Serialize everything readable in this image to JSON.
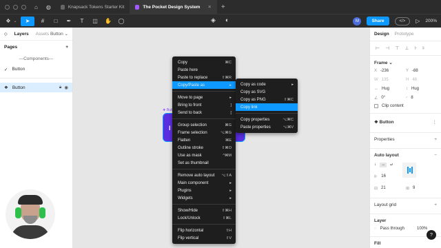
{
  "titlebar": {
    "tabs": [
      {
        "label": "Knapsack Tokens Starter Kit",
        "active": false
      },
      {
        "label": "The Pocket Design System",
        "active": true
      }
    ],
    "add": "+"
  },
  "toolbar": {
    "user_initial": "M",
    "share_label": "Share",
    "code_label": "</>",
    "zoom": "200%"
  },
  "left_panel": {
    "tabs": [
      "Layers",
      "Assets"
    ],
    "component": "Button",
    "pages_label": "Pages",
    "pages_add": "+",
    "pages": [
      "---Components---",
      "Button"
    ],
    "page_check": "✓",
    "layer": "Button"
  },
  "canvas": {
    "frame_label": "Butt",
    "frame_icon": "I"
  },
  "context_menu": {
    "items": [
      {
        "label": "Copy",
        "shortcut": "⌘C"
      },
      {
        "label": "Paste here",
        "shortcut": ""
      },
      {
        "label": "Paste to replace",
        "shortcut": "⇧⌘R"
      },
      {
        "label": "Copy/Paste as",
        "shortcut": "▸",
        "highlight": true
      },
      {
        "sep": true
      },
      {
        "label": "Move to page",
        "shortcut": "▸"
      },
      {
        "label": "Bring to front",
        "shortcut": "]"
      },
      {
        "label": "Send to back",
        "shortcut": "["
      },
      {
        "sep": true
      },
      {
        "label": "Group selection",
        "shortcut": "⌘G"
      },
      {
        "label": "Frame selection",
        "shortcut": "⌥⌘G"
      },
      {
        "label": "Flatten",
        "shortcut": "⌘E"
      },
      {
        "label": "Outline stroke",
        "shortcut": "⇧⌘O"
      },
      {
        "label": "Use as mask",
        "shortcut": "^⌘M"
      },
      {
        "label": "Set as thumbnail",
        "shortcut": ""
      },
      {
        "sep": true
      },
      {
        "label": "Remove auto layout",
        "shortcut": "⌥⇧A"
      },
      {
        "label": "Main component",
        "shortcut": "▸"
      },
      {
        "label": "Plugins",
        "shortcut": "▸"
      },
      {
        "label": "Widgets",
        "shortcut": "▸"
      },
      {
        "sep": true
      },
      {
        "label": "Show/Hide",
        "shortcut": "⇧⌘H"
      },
      {
        "label": "Lock/Unlock",
        "shortcut": "⇧⌘L"
      },
      {
        "sep": true
      },
      {
        "label": "Flip horizontal",
        "shortcut": "⇧H"
      },
      {
        "label": "Flip vertical",
        "shortcut": "⇧V"
      }
    ]
  },
  "submenu": {
    "items": [
      {
        "label": "Copy as code",
        "shortcut": "▸"
      },
      {
        "label": "Copy as SVG",
        "shortcut": ""
      },
      {
        "label": "Copy as PNG",
        "shortcut": "⇧⌘C"
      },
      {
        "label": "Copy link",
        "shortcut": "",
        "highlight": true
      },
      {
        "sep": true
      },
      {
        "label": "Copy properties",
        "shortcut": "⌥⌘C"
      },
      {
        "label": "Paste properties",
        "shortcut": "⌥⌘V"
      }
    ]
  },
  "right_panel": {
    "tabs": [
      "Design",
      "Prototype"
    ],
    "frame_title": "Frame",
    "frame_arrow": "⌄",
    "x_label": "X",
    "x_value": "-236",
    "y_label": "Y",
    "y_value": "-88",
    "w_value": "135",
    "h_value": "48",
    "hug_w": "Hug",
    "hug_h": "Hug",
    "rotation": "0°",
    "radius": "8",
    "clip_content": "Clip content",
    "component_name": "Button",
    "properties_label": "Properties",
    "auto_layout_label": "Auto layout",
    "gap_value": "16",
    "pad_h": "21",
    "pad_v": "9",
    "layout_grid_label": "Layout grid",
    "layer_label": "Layer",
    "blend_mode": "Pass through",
    "opacity": "100%",
    "fill_label": "Fill",
    "help": "?"
  },
  "colors": {
    "accent": "#0d99ff",
    "component_fill": "#5b2ee0",
    "menu_bg": "#1e1e1e",
    "chrome_bg": "#2c2c2c"
  }
}
